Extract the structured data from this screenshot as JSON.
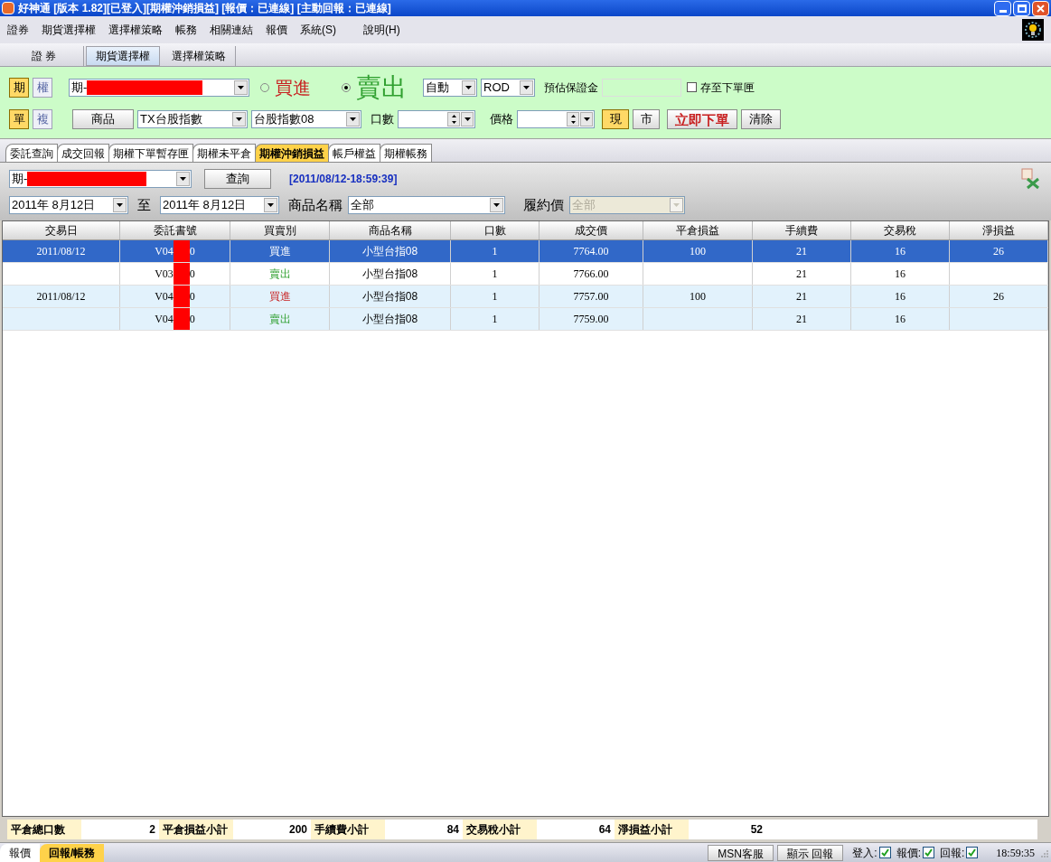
{
  "window": {
    "title": "好神通 [版本 1.82][已登入][期權沖銷損益] [報價：已連線] [主動回報：已連線]"
  },
  "menu": [
    "證券",
    "期貨選擇權",
    "選擇權策略",
    "帳務",
    "相關連結",
    "報價",
    "系統(S)",
    "說明(H)"
  ],
  "main_tabs": [
    {
      "label": "證 券",
      "selected": false
    },
    {
      "label": "期貨選擇權",
      "selected": true
    },
    {
      "label": "選擇權策略",
      "selected": false
    }
  ],
  "order_panel": {
    "type_buttons": [
      {
        "label": "期",
        "selected": true
      },
      {
        "label": "權",
        "selected": false
      }
    ],
    "account_prefix": "期-",
    "sides": [
      {
        "label": "買進",
        "selected": false,
        "kind": "buy"
      },
      {
        "label": "賣出",
        "selected": true,
        "kind": "sell"
      }
    ],
    "condition": "自動",
    "order_type": "ROD",
    "margin_label": "預估保證金",
    "save_label": "存至下單匣",
    "save_checked": false,
    "leg_buttons": [
      {
        "label": "單",
        "selected": true
      },
      {
        "label": "複",
        "selected": false
      }
    ],
    "product_button": "商品",
    "product": "TX台股指數",
    "contract": "台股指數08",
    "qty_label": "口數",
    "price_label": "價格",
    "price_buttons": [
      {
        "label": "現",
        "selected": true
      },
      {
        "label": "市",
        "selected": false
      }
    ],
    "submit_button": "立即下單",
    "clear_button": "清除"
  },
  "sub_tabs": [
    {
      "label": "委託查詢",
      "selected": false
    },
    {
      "label": "成交回報",
      "selected": false
    },
    {
      "label": "期權下單暫存匣",
      "selected": false
    },
    {
      "label": "期權未平倉",
      "selected": false
    },
    {
      "label": "期權沖銷損益",
      "selected": true
    },
    {
      "label": "帳戶權益",
      "selected": false
    },
    {
      "label": "期權帳務",
      "selected": false
    }
  ],
  "filter": {
    "account_prefix": "期-",
    "query_button": "查詢",
    "timestamp": "[2011/08/12-18:59:39]",
    "date_from": "2011年  8月12日",
    "to_label": "至",
    "date_to": "2011年  8月12日",
    "product_label": "商品名稱",
    "product": "全部",
    "strike_label": "履約價",
    "strike": "全部",
    "strike_disabled": true
  },
  "table": {
    "columns": [
      "交易日",
      "委託書號",
      "買賣別",
      "商品名稱",
      "口數",
      "成交價",
      "平倉損益",
      "手續費",
      "交易稅",
      "淨損益"
    ],
    "rows": [
      {
        "selected": true,
        "date": "2011/08/12",
        "order_start": "V04",
        "order_end": "0",
        "side": "買進",
        "product": "小型台指08",
        "qty": "1",
        "price": "7764.00",
        "close_pl": "100",
        "fee": "21",
        "tax": "16",
        "net": "26"
      },
      {
        "selected": false,
        "shaded": false,
        "order_start": "V03",
        "order_end": "0",
        "side": "賣出",
        "kind": "sell",
        "product": "小型台指08",
        "qty": "1",
        "price": "7766.00",
        "fee": "21",
        "tax": "16"
      },
      {
        "selected": false,
        "shaded": true,
        "date": "2011/08/12",
        "order_start": "V04",
        "order_end": "0",
        "side": "買進",
        "kind": "buy",
        "product": "小型台指08",
        "qty": "1",
        "price": "7757.00",
        "close_pl": "100",
        "fee": "21",
        "tax": "16",
        "net": "26"
      },
      {
        "selected": false,
        "shaded": true,
        "order_start": "V04",
        "order_end": "0",
        "side": "賣出",
        "kind": "sell",
        "product": "小型台指08",
        "qty": "1",
        "price": "7759.00",
        "fee": "21",
        "tax": "16"
      }
    ]
  },
  "summary": [
    {
      "label": "平倉總口數",
      "value": "2"
    },
    {
      "label": "平倉損益小計",
      "value": "200"
    },
    {
      "label": "手續費小計",
      "value": "84"
    },
    {
      "label": "交易稅小計",
      "value": "64"
    },
    {
      "label": "淨損益小計",
      "value": "52"
    }
  ],
  "status_bar": {
    "tabs": [
      {
        "label": "報價",
        "selected": false
      },
      {
        "label": "回報/帳務",
        "selected": true
      }
    ],
    "buttons": [
      "MSN客服",
      "顯示 回報"
    ],
    "checks": [
      {
        "label": "登入:",
        "checked": true
      },
      {
        "label": "報價:",
        "checked": true
      },
      {
        "label": "回報:",
        "checked": true
      }
    ],
    "time": "18:59:35"
  }
}
